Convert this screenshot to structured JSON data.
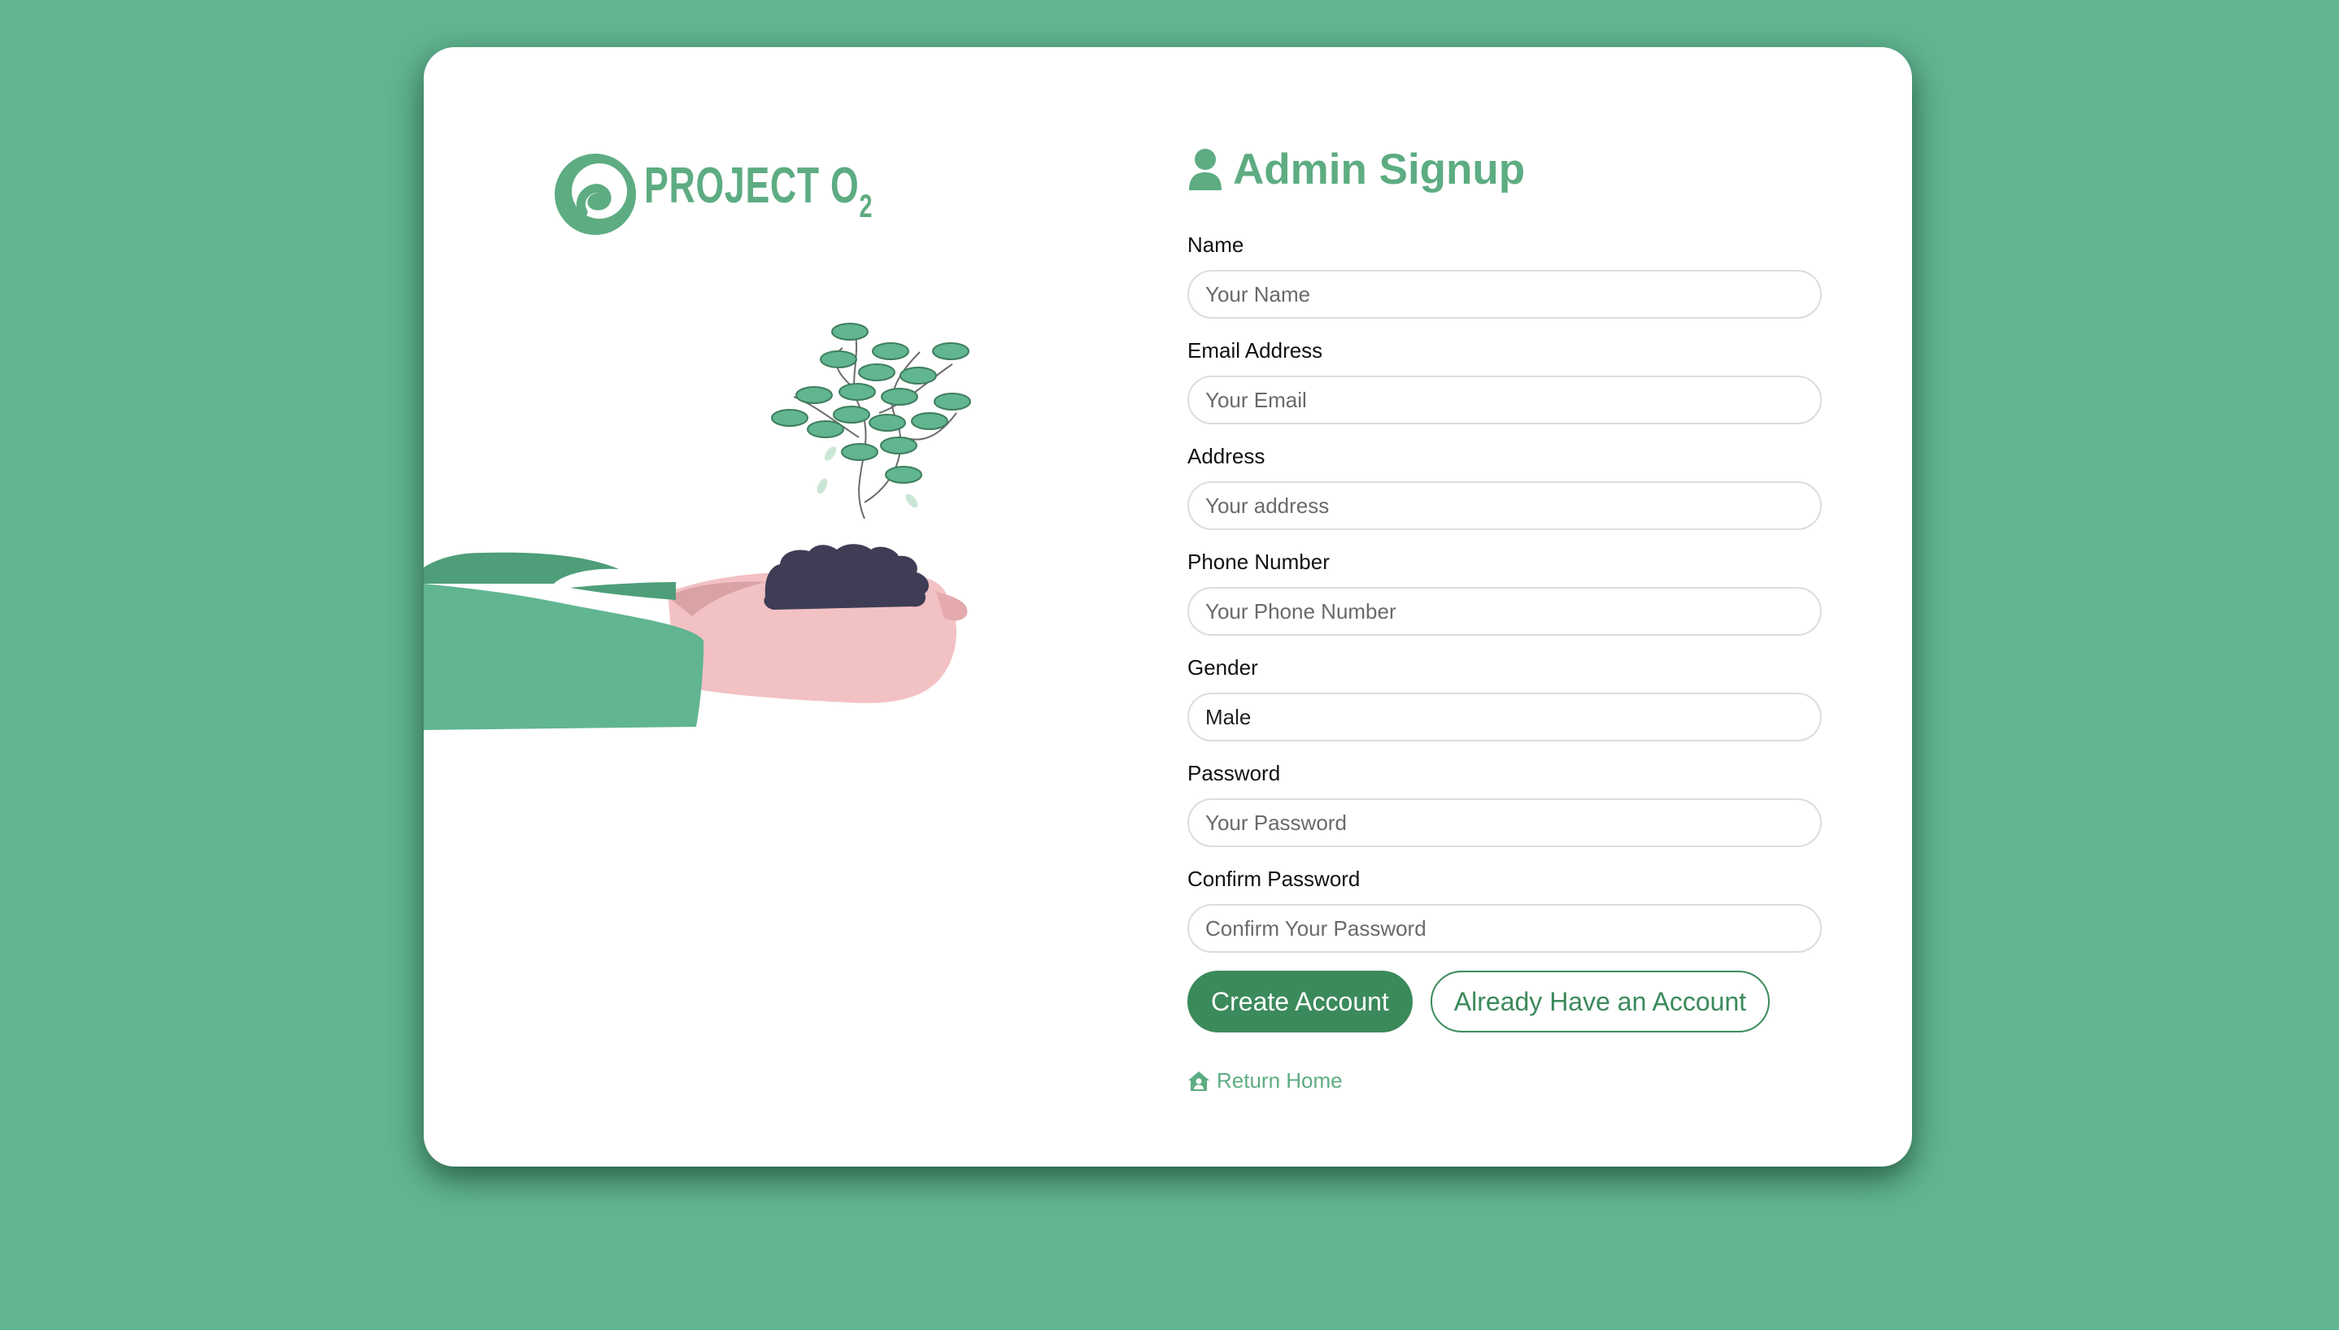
{
  "brand": {
    "logo_text": "PROJECT O",
    "logo_subscript": "2",
    "color": "#5dac82"
  },
  "form": {
    "title": "Admin Signup",
    "title_icon": "user-icon",
    "fields": [
      {
        "label": "Name",
        "placeholder": "Your Name"
      },
      {
        "label": "Email Address",
        "placeholder": "Your Email"
      },
      {
        "label": "Address",
        "placeholder": "Your address"
      },
      {
        "label": "Phone Number",
        "placeholder": "Your Phone Number"
      },
      {
        "label": "Gender",
        "value": "Male"
      },
      {
        "label": "Password",
        "placeholder": "Your Password"
      },
      {
        "label": "Confirm Password",
        "placeholder": "Confirm Your Password"
      }
    ],
    "create_label": "Create Account",
    "existing_label": "Already Have an Account",
    "home_label": "Return Home",
    "home_icon": "house-user-icon"
  },
  "colors": {
    "background": "#61b591",
    "primary": "#3b8a5b",
    "accent": "#5dac82"
  }
}
